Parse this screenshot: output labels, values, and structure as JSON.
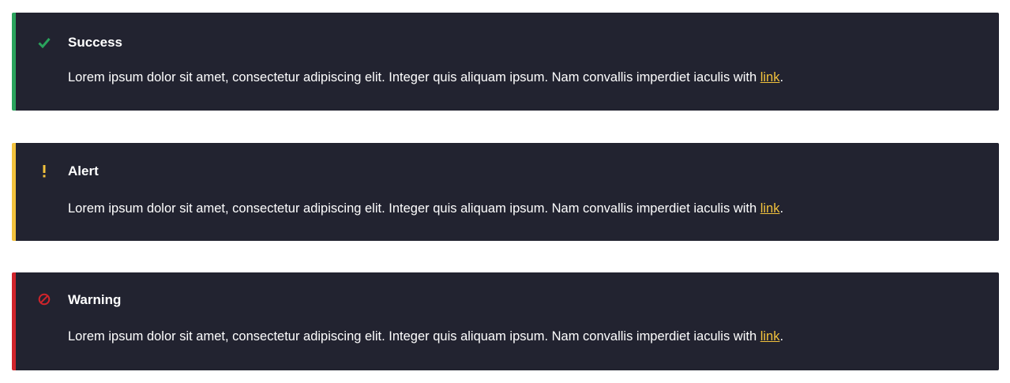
{
  "alerts": [
    {
      "icon": "check-icon",
      "title": "Success",
      "text": "Lorem ipsum dolor sit amet, consectetur adipiscing elit. Integer quis aliquam ipsum. Nam convallis imperdiet iaculis with ",
      "link": "link",
      "trail": ".",
      "accent": "#2aa35c"
    },
    {
      "icon": "exclamation-icon",
      "title": "Alert",
      "text": "Lorem ipsum dolor sit amet, consectetur adipiscing elit. Integer quis aliquam ipsum. Nam convallis imperdiet iaculis with ",
      "link": "link",
      "trail": ".",
      "accent": "#f2c23c"
    },
    {
      "icon": "prohibited-icon",
      "title": "Warning",
      "text": "Lorem ipsum dolor sit amet, consectetur adipiscing elit. Integer quis aliquam ipsum. Nam convallis imperdiet iaculis with ",
      "link": "link",
      "trail": ".",
      "accent": "#d0242b"
    }
  ],
  "colors": {
    "panel_bg": "#222330",
    "text": "#ffffff",
    "link": "#f2c23c"
  }
}
